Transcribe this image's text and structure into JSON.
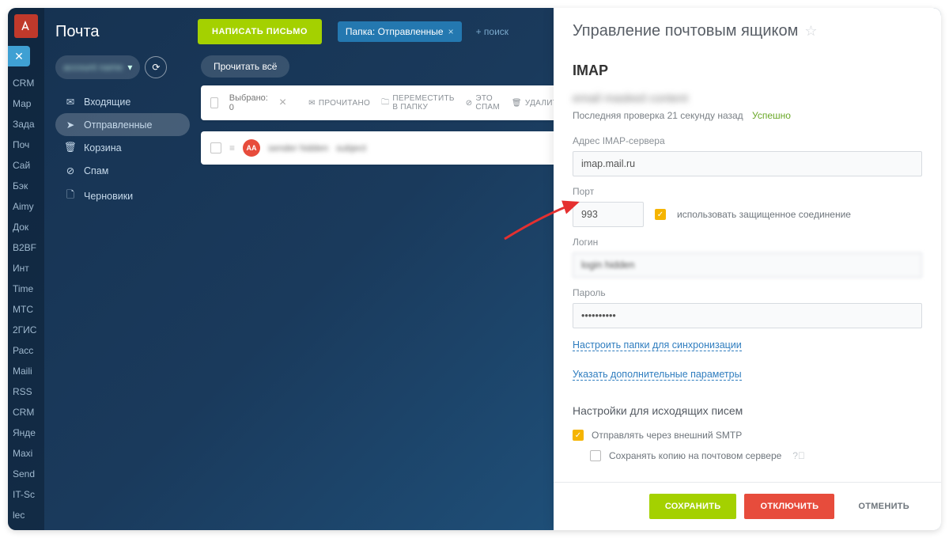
{
  "rail": {
    "items": [
      "CRM",
      "Мар",
      "Зада",
      "Поч",
      "Сай",
      "Бэк",
      "Aimy",
      "Док",
      "B2BF",
      "Инт",
      "Time",
      "МТС",
      "2ГИС",
      "Расс",
      "Maili",
      "RSS",
      "CRM",
      "Янде",
      "Maxi",
      "Send",
      "IT-Sc",
      "lec"
    ]
  },
  "header": {
    "page_title": "Почта",
    "compose": "НАПИСАТЬ ПИСЬМО",
    "folder_tab": "Папка: Отправленные",
    "search_placeholder": "+ поиск"
  },
  "account": {
    "masked": "account name"
  },
  "folders": [
    {
      "icon": "✉",
      "label": "Входящие"
    },
    {
      "icon": "➤",
      "label": "Отправленные"
    },
    {
      "icon": "🗑",
      "label": "Корзина"
    },
    {
      "icon": "⊘",
      "label": "Спам"
    },
    {
      "icon": "🗋",
      "label": "Черновики"
    }
  ],
  "list": {
    "read_all": "Прочитать всё",
    "toolbar": {
      "selected_label": "Выбрано: 0",
      "mark_read": "ПРОЧИТАНО",
      "move": "ПЕРЕМЕСТИТЬ В ПАПКУ",
      "spam": "ЭТО СПАМ",
      "delete": "УДАЛИТЬ"
    },
    "message": {
      "avatar_initials": "АА"
    }
  },
  "panel": {
    "title": "Управление почтовым ящиком",
    "section": "IMAP",
    "check_line": "Последняя проверка 21 секунду назад",
    "check_status": "Успешно",
    "fields": {
      "server_label": "Адрес IMAP-сервера",
      "server_value": "imap.mail.ru",
      "port_label": "Порт",
      "port_value": "993",
      "secure_label": "использовать защищенное соединение",
      "login_label": "Логин",
      "login_value": "login hidden",
      "password_label": "Пароль",
      "password_value": "••••••••••"
    },
    "links": {
      "sync_folders": "Настроить папки для синхронизации",
      "additional": "Указать дополнительные параметры"
    },
    "outgoing": {
      "heading": "Настройки для исходящих писем",
      "external_smtp": "Отправлять через внешний SMTP",
      "keep_copy": "Сохранять копию на почтовом сервере"
    },
    "buttons": {
      "save": "СОХРАНИТЬ",
      "disconnect": "ОТКЛЮЧИТЬ",
      "cancel": "ОТМЕНИТЬ"
    }
  }
}
